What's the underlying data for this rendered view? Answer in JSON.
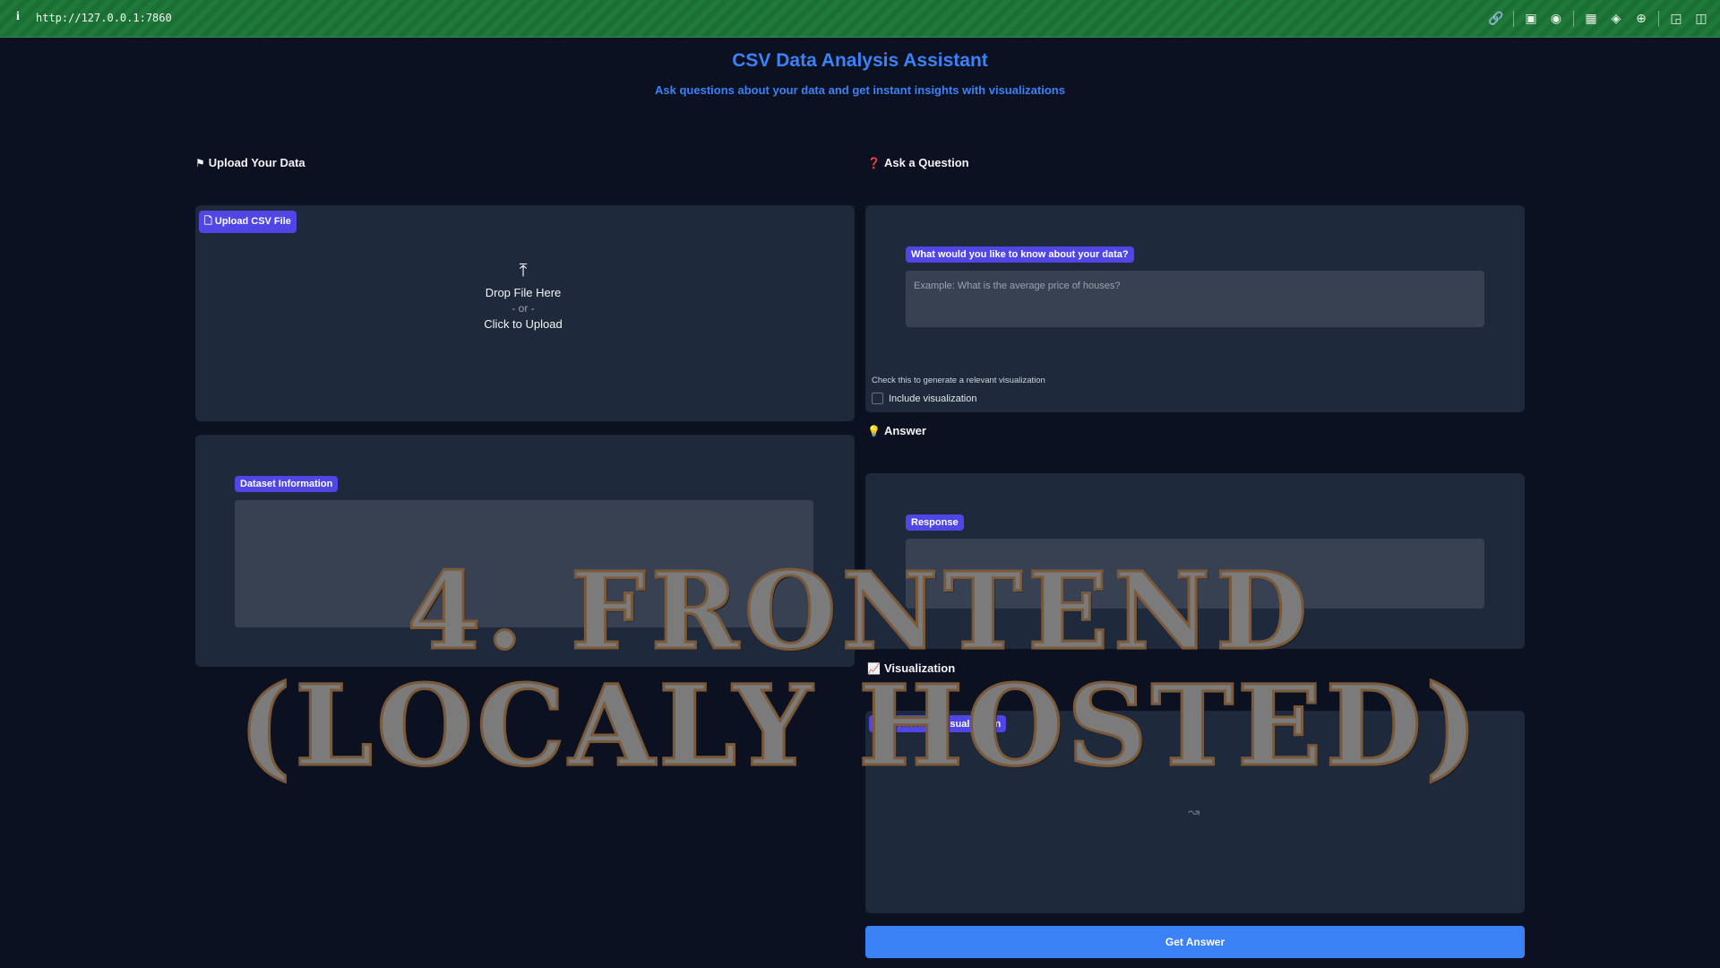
{
  "browser": {
    "info_icon": "info-icon",
    "url": "http://127.0.0.1:7860",
    "icons": [
      "link-icon",
      "screen-icon",
      "camera-icon",
      "terminal-icon",
      "globe-icon",
      "crosshair-icon",
      "puzzle-icon",
      "sidebar-icon"
    ]
  },
  "header": {
    "title": "CSV Data Analysis Assistant",
    "subtitle": "Ask questions about your data and get instant insights with visualizations"
  },
  "upload": {
    "section_title": "Upload Your Data",
    "section_icon": "flag-icon",
    "badge": "Upload CSV File",
    "drop_text": "Drop File Here",
    "or_text": "- or -",
    "click_text": "Click to Upload"
  },
  "dataset": {
    "badge": "Dataset Information"
  },
  "question": {
    "section_title": "Ask a Question",
    "section_icon": "question-mark-icon",
    "badge": "What would you like to know about your data?",
    "placeholder": "Example: What is the average price of houses?",
    "hint": "Check this to generate a relevant visualization",
    "checkbox_label": "Include visualization",
    "checkbox_checked": false
  },
  "answer": {
    "section_title": "Answer",
    "section_icon": "lightbulb-icon",
    "badge": "Response"
  },
  "visualization": {
    "section_title": "Visualization",
    "section_icon": "chart-icon",
    "badge": "Generated Visualization",
    "empty_icon": "chart-icon"
  },
  "actions": {
    "get_answer": "Get Answer"
  },
  "overlay": {
    "line1": "4. FRONTEND",
    "line2": "(LOCALY HOSTED)"
  },
  "colors": {
    "accent": "#3b82f6",
    "badge": "#4f46e5",
    "background": "#0b1120",
    "panel": "#1e293b"
  }
}
